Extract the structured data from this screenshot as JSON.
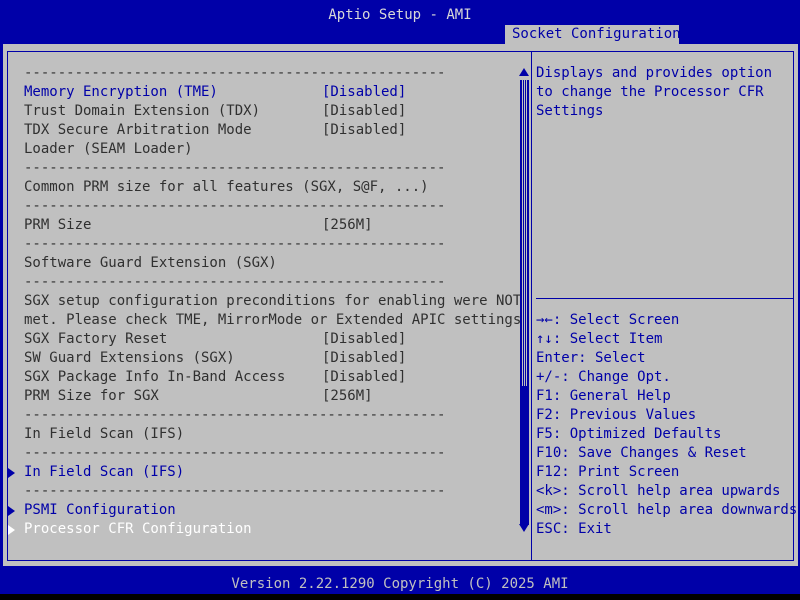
{
  "header": {
    "title": "Aptio Setup - AMI",
    "tab": "Socket Configuration"
  },
  "colors": {
    "background": "#0000a8",
    "panel": "#c0c0c0",
    "text": "#303030",
    "highlight": "#0000a8",
    "selected": "#ffffff"
  },
  "left": {
    "sep": "--------------------------------------------------",
    "items": [
      {
        "label": "Memory Encryption (TME)",
        "value": "[Disabled]"
      },
      {
        "label": "Trust Domain Extension (TDX)",
        "value": "[Disabled]"
      },
      {
        "label": "TDX Secure Arbitration Mode",
        "value": "[Disabled]"
      },
      {
        "label": "Loader (SEAM Loader)"
      },
      {
        "label": "Common PRM size for all features (SGX, S@F, ...)"
      },
      {
        "label": "PRM Size",
        "value": "[256M]"
      },
      {
        "label": "Software Guard Extension (SGX)"
      },
      {
        "label": "SGX setup configuration preconditions for enabling were NOT"
      },
      {
        "label": "met. Please check TME, MirrorMode or Extended APIC settings."
      },
      {
        "label": "SGX Factory Reset",
        "value": "[Disabled]"
      },
      {
        "label": "SW Guard Extensions (SGX)",
        "value": "[Disabled]"
      },
      {
        "label": "SGX Package Info In-Band Access",
        "value": "[Disabled]"
      },
      {
        "label": "PRM Size for SGX",
        "value": "[256M]"
      },
      {
        "label": "In Field Scan (IFS)"
      },
      {
        "label": "In Field Scan (IFS)"
      },
      {
        "label": "PSMI Configuration"
      },
      {
        "label": "Processor CFR Configuration"
      }
    ]
  },
  "help": {
    "desc": [
      "Displays and provides option",
      "to change the Processor CFR",
      "Settings"
    ],
    "keys": [
      "→←: Select Screen",
      "↑↓: Select Item",
      "Enter: Select",
      "+/-: Change Opt.",
      "F1: General Help",
      "F2: Previous Values",
      "F5: Optimized Defaults",
      "F10: Save Changes & Reset",
      "F12: Print Screen",
      "<k>: Scroll help area upwards",
      "<m>: Scroll help area downwards",
      "ESC: Exit"
    ]
  },
  "footer": {
    "text": "Version 2.22.1290 Copyright (C) 2025 AMI"
  }
}
